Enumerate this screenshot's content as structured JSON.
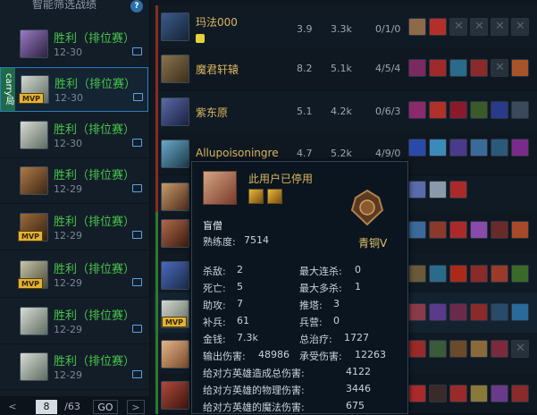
{
  "sidebar": {
    "header": "智能筛选战绩",
    "help": "?",
    "carry_label": "carry局",
    "matches": [
      {
        "result": "胜利（排位赛）",
        "date": "12-30",
        "mvp": false,
        "selected": false
      },
      {
        "result": "胜利（排位赛）",
        "date": "12-30",
        "mvp": true,
        "selected": true
      },
      {
        "result": "胜利（排位赛）",
        "date": "12-30",
        "mvp": false,
        "selected": false
      },
      {
        "result": "胜利（排位赛）",
        "date": "12-29",
        "mvp": false,
        "selected": false
      },
      {
        "result": "胜利（排位赛）",
        "date": "12-29",
        "mvp": true,
        "selected": false
      },
      {
        "result": "胜利（排位赛）",
        "date": "12-29",
        "mvp": true,
        "selected": false
      },
      {
        "result": "胜利（排位赛）",
        "date": "12-29",
        "mvp": false,
        "selected": false
      },
      {
        "result": "胜利（排位赛）",
        "date": "12-29",
        "mvp": false,
        "selected": false
      }
    ],
    "mvp_label": "MVP",
    "pagination": {
      "prev": "<",
      "page": "8",
      "total": "/63",
      "go": "GO",
      "next": ">"
    }
  },
  "players": [
    {
      "name": "玛法000",
      "rating": "3.9",
      "damage": "3.3k",
      "kda": "0/1/0"
    },
    {
      "name": "魔君轩辕",
      "rating": "8.2",
      "damage": "5.1k",
      "kda": "4/5/4"
    },
    {
      "name": "紫东原",
      "rating": "5.1",
      "damage": "4.2k",
      "kda": "0/6/3"
    },
    {
      "name": "Allupoisoningre",
      "rating": "4.7",
      "damage": "5.2k",
      "kda": "4/9/0"
    }
  ],
  "tooltip": {
    "username": "此用户已停用",
    "champion": "盲僧",
    "proficiency_label": "熟练度:",
    "proficiency": "7514",
    "rank": "青铜Ⅴ",
    "stats": [
      {
        "label": "杀敌:",
        "value": "2"
      },
      {
        "label": "最大连杀:",
        "value": "0"
      },
      {
        "label": "死亡:",
        "value": "5"
      },
      {
        "label": "最大多杀:",
        "value": "1"
      },
      {
        "label": "助攻:",
        "value": "7"
      },
      {
        "label": "推塔:",
        "value": "3"
      },
      {
        "label": "补兵:",
        "value": "61"
      },
      {
        "label": "兵营:",
        "value": "0"
      },
      {
        "label": "金钱:",
        "value": "7.3k"
      },
      {
        "label": "总治疗:",
        "value": "1727"
      },
      {
        "label": "输出伤害:",
        "value": "48986"
      },
      {
        "label": "承受伤害:",
        "value": "12263"
      }
    ],
    "long_stats": [
      {
        "label": "给对方英雄造成总伤害:",
        "value": "4122"
      },
      {
        "label": "给对方英雄的物理伤害:",
        "value": "3446"
      },
      {
        "label": "给对方英雄的魔法伤害:",
        "value": "675"
      }
    ]
  },
  "colors": {
    "win_text": "#47c44b",
    "player_name": "#d8b660",
    "accent": "#2f7bb9",
    "mvp": "#e0b43a"
  }
}
